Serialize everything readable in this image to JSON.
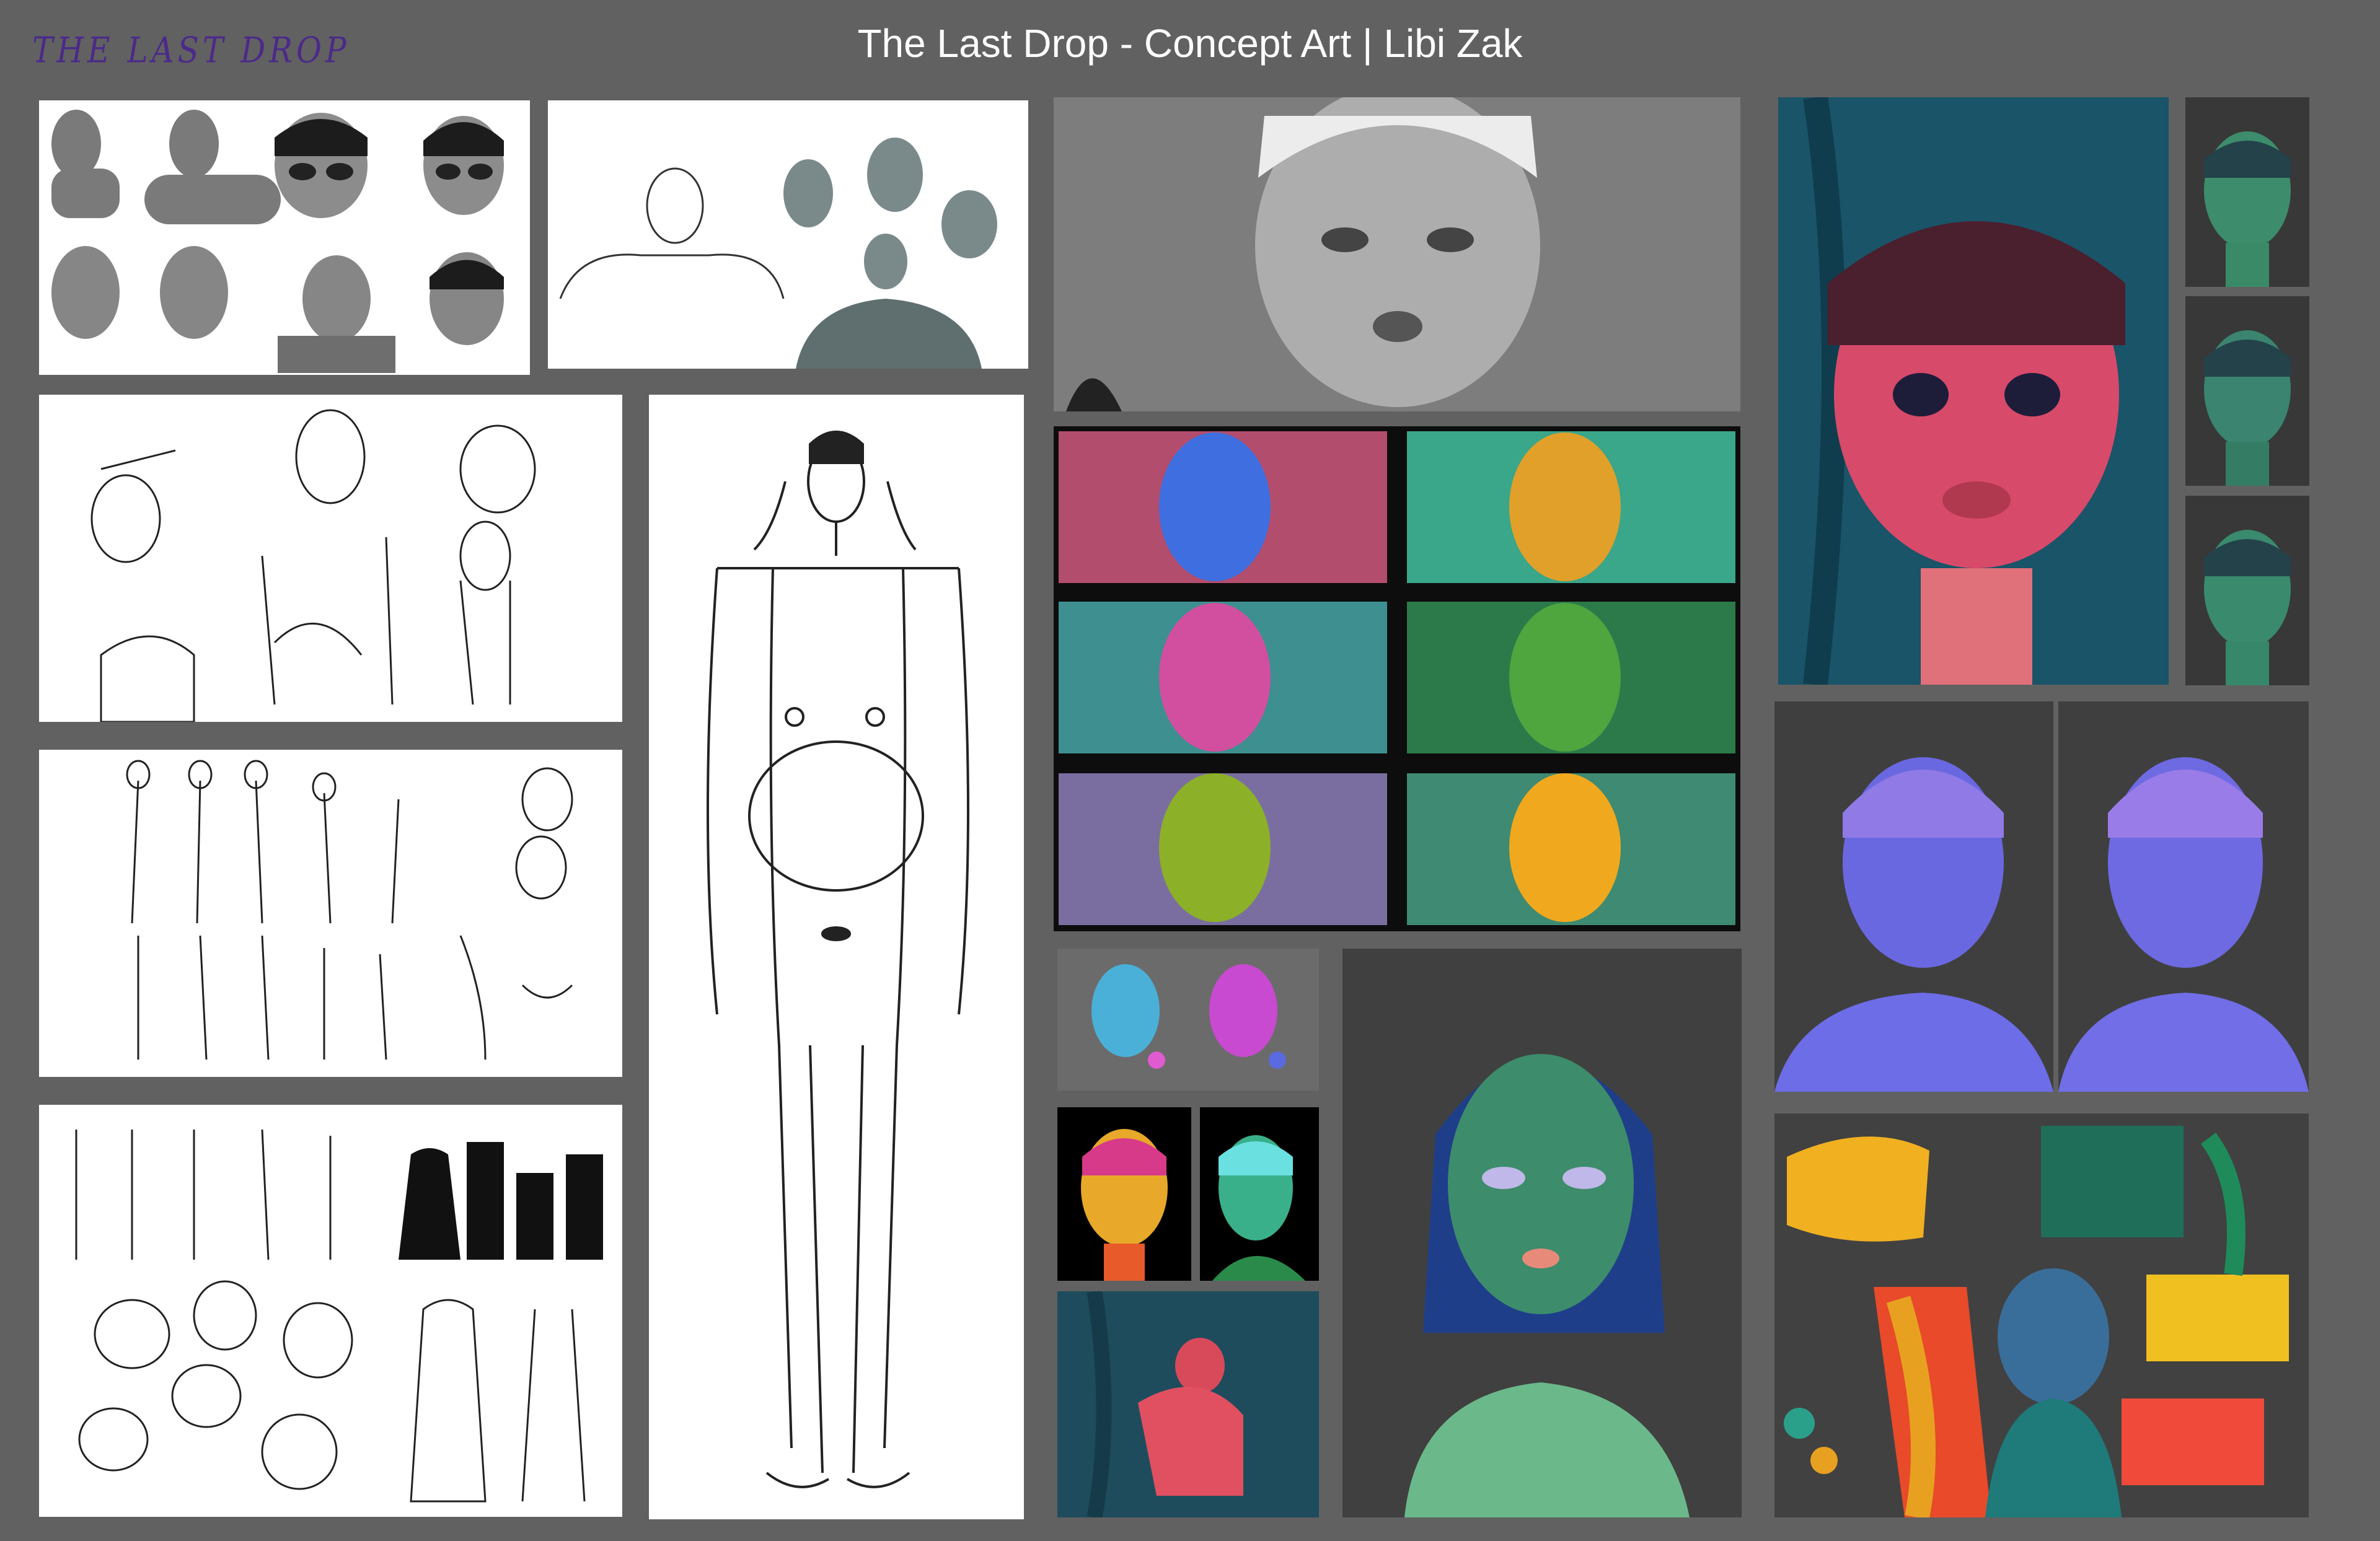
{
  "header": {
    "title": "The Last Drop - Concept Art | Libi Zak",
    "logo_text": "THE LAST DROP"
  },
  "colors": {
    "background": "#616161",
    "title_text": "#ffffff",
    "logo_text": "#4b2a8a",
    "sketch_paper": "#ffffff",
    "dark_panel": "#424242"
  },
  "panels": [
    "3d-head-sculpts",
    "3d-head-variants",
    "greyscale-frame",
    "sketch-poses-1",
    "full-body-sketch",
    "color-key-grid",
    "red-portrait",
    "green-portrait-1",
    "green-portrait-2",
    "green-portrait-3",
    "sketch-poses-2",
    "purple-portrait-1",
    "purple-portrait-2",
    "sketch-silhouettes",
    "color-heads-thumb",
    "neon-head-1",
    "neon-head-2",
    "crouching-figure",
    "green-woman-portrait",
    "jungle-collage"
  ]
}
